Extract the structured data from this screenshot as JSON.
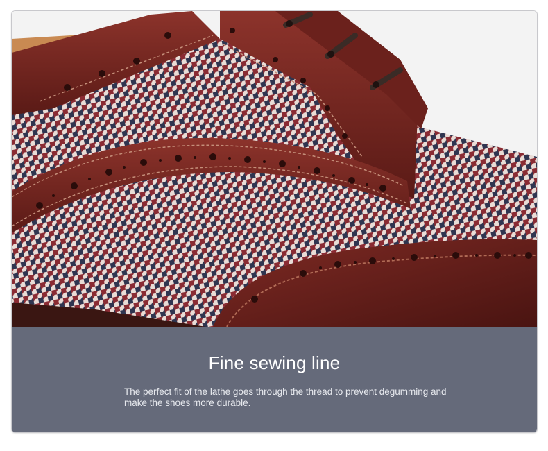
{
  "feature": {
    "title": "Fine sewing line",
    "description": "The perfect fit of the lathe goes through the thread to prevent degumming and make the shoes more durable."
  },
  "image": {
    "subject_icon": "brogue-shoe-closeup-photo",
    "colors": {
      "leather": "#7a2a24",
      "leather_dark": "#4e1613",
      "houndstooth_red": "#8a2b33",
      "houndstooth_navy": "#2f3550",
      "houndstooth_light": "#e9dcd6",
      "laces": "#3a2b26",
      "caption_panel": "#656a7a"
    }
  }
}
